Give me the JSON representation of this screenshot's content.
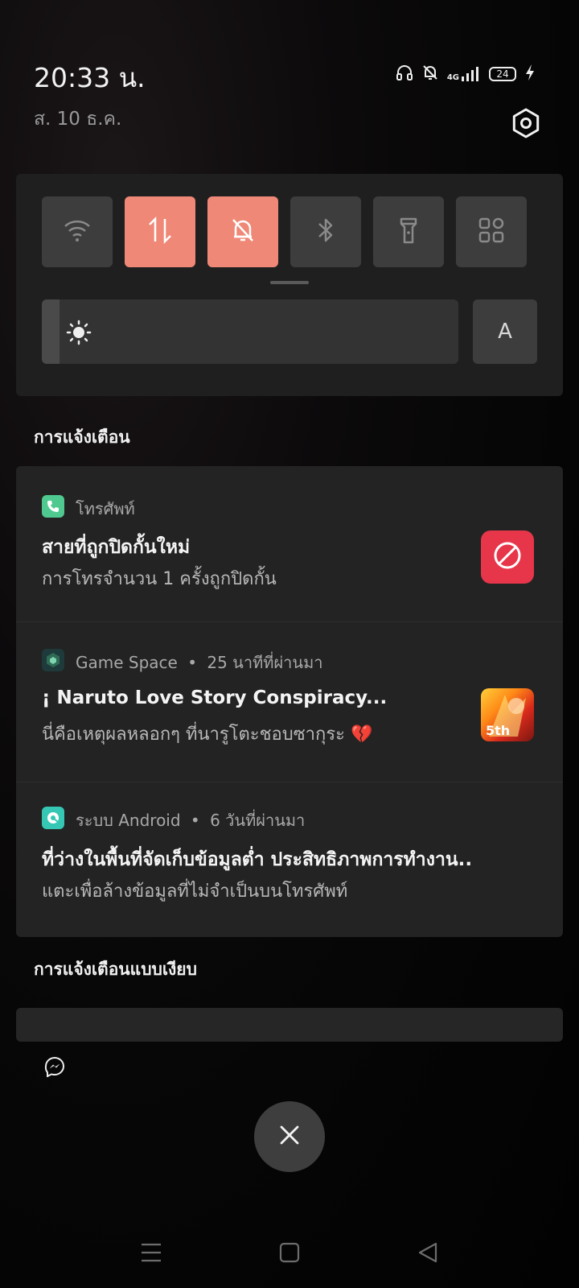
{
  "status_bar": {
    "time": "20:33 น.",
    "date": "ส. 10 ธ.ค.",
    "network": "4G",
    "battery": "24",
    "icons": [
      "headphones-icon",
      "bell-off-icon",
      "signal-icon",
      "battery-icon",
      "charging-icon"
    ]
  },
  "quick_settings": {
    "tiles": [
      {
        "name": "wifi",
        "icon": "wifi-icon",
        "active": false
      },
      {
        "name": "mobile-data",
        "icon": "data-arrows-icon",
        "active": true
      },
      {
        "name": "silent",
        "icon": "bell-off-icon",
        "active": true
      },
      {
        "name": "bluetooth",
        "icon": "bluetooth-icon",
        "active": false
      },
      {
        "name": "flashlight",
        "icon": "flashlight-icon",
        "active": false
      },
      {
        "name": "more",
        "icon": "grid-icon",
        "active": false
      }
    ],
    "brightness_level": 0.04,
    "auto_label": "A"
  },
  "notifications": {
    "section_title": "การแจ้งเตือน",
    "items": [
      {
        "app": "โทรศัพท์",
        "time": "",
        "title": "สายที่ถูกปิดกั้นใหม่",
        "body": "การโทรจำนวน 1 ครั้งถูกปิดกั้น",
        "icon": "phone-icon",
        "accent": "#4fc98f"
      },
      {
        "app": "Game Space",
        "time": "25 นาทีที่ผ่านมา",
        "title": "¡ Naruto Love Story Conspiracy...",
        "body": "นี่คือเหตุผลหลอกๆ ที่นารูโตะชอบซากุระ 💔",
        "icon": "game-space-icon",
        "thumb_label": "5th"
      },
      {
        "app": "ระบบ Android",
        "time": "6 วันที่ผ่านมา",
        "title": "ที่ว่างในพื้นที่จัดเก็บข้อมูลต่ำ ประสิทธิภาพการทำงาน..",
        "body": "แตะเพื่อล้างข้อมูลที่ไม่จำเป็นบนโทรศัพท์",
        "icon": "storage-cleaner-icon",
        "accent": "#35c7b3"
      }
    ]
  },
  "silent_section": {
    "title": "การแจ้งเตือนแบบเงียบ",
    "icon": "messenger-icon"
  },
  "separator": "•",
  "colors": {
    "tile_active": "#ef8876",
    "tile_inactive": "#3d3d3d",
    "block_red": "#e7364a"
  }
}
